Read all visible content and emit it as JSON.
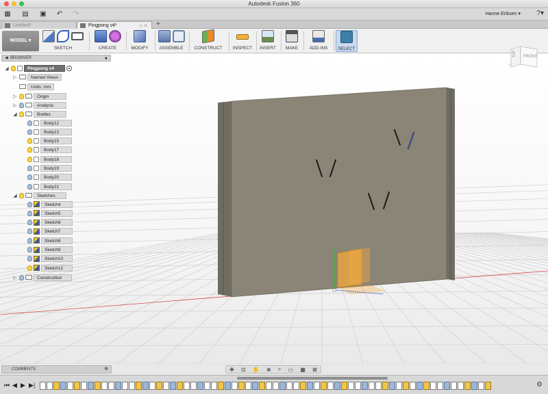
{
  "window": {
    "title": "Autodesk Fusion 360"
  },
  "user": {
    "name": "Hanne Eriksen"
  },
  "tabs": [
    {
      "label": "Untitled*",
      "active": false
    },
    {
      "label": "Pingpong v4*",
      "active": true
    }
  ],
  "toolbar": {
    "workspace": "MODEL",
    "groups": [
      {
        "label": "SKETCH"
      },
      {
        "label": "CREATE"
      },
      {
        "label": "MODIFY"
      },
      {
        "label": "ASSEMBLE"
      },
      {
        "label": "CONSTRUCT"
      },
      {
        "label": "INSPECT"
      },
      {
        "label": "INSERT"
      },
      {
        "label": "MAKE"
      },
      {
        "label": "ADD-INS"
      },
      {
        "label": "SELECT"
      }
    ]
  },
  "viewcube": {
    "top": "TOP",
    "front": "FRONT"
  },
  "browser": {
    "title": "BROWSER",
    "root": "Pingpong v4",
    "items": [
      {
        "label": "Named Views"
      },
      {
        "label": "Units: mm"
      },
      {
        "label": "Origin"
      },
      {
        "label": "Analysis"
      },
      {
        "label": "Bodies"
      },
      {
        "label": "Body12"
      },
      {
        "label": "Body13"
      },
      {
        "label": "Body15"
      },
      {
        "label": "Body17"
      },
      {
        "label": "Body18"
      },
      {
        "label": "Body19"
      },
      {
        "label": "Body20"
      },
      {
        "label": "Body21"
      },
      {
        "label": "Sketches"
      },
      {
        "label": "Sketch4"
      },
      {
        "label": "Sketch5"
      },
      {
        "label": "Sketch6"
      },
      {
        "label": "Sketch7"
      },
      {
        "label": "Sketch8"
      },
      {
        "label": "Sketch9"
      },
      {
        "label": "Sketch10"
      },
      {
        "label": "Sketch12"
      },
      {
        "label": "Construction"
      }
    ]
  },
  "comments": {
    "title": "COMMENTS"
  },
  "colors": {
    "wall": "#8a8576",
    "selection": "#f2a93b",
    "axis_x": "#d64a4a",
    "axis_y": "#3fae3f",
    "axis_z": "#3a5fd6"
  }
}
